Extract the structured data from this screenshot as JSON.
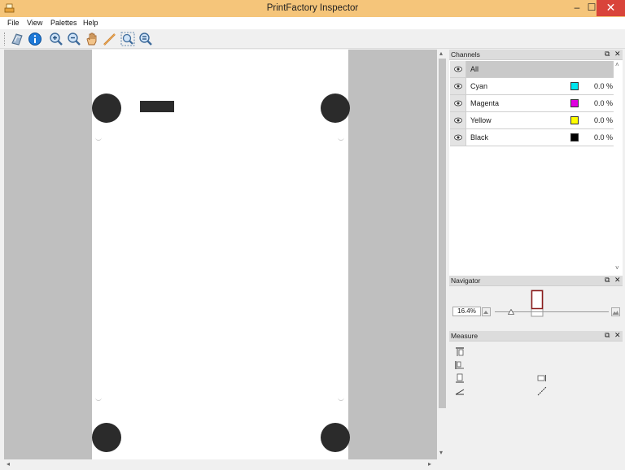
{
  "window": {
    "title": "PrintFactory Inspector",
    "controls": {
      "minimize": "–",
      "maximize": "☐",
      "close": "✕"
    }
  },
  "menu": [
    "File",
    "View",
    "Palettes",
    "Help"
  ],
  "toolbar": {
    "tools": [
      "open-file",
      "info",
      "zoom-in",
      "zoom-out",
      "pan-hand",
      "measure-ruler",
      "zoom-fit",
      "zoom-actual"
    ]
  },
  "palettes": {
    "channels": {
      "title": "Channels",
      "rows": [
        {
          "name": "All",
          "color": "",
          "percent": "",
          "selected": true
        },
        {
          "name": "Cyan",
          "color": "#00e5ee",
          "percent": "0.0 %",
          "selected": false
        },
        {
          "name": "Magenta",
          "color": "#e000e0",
          "percent": "0.0 %",
          "selected": false
        },
        {
          "name": "Yellow",
          "color": "#ffff00",
          "percent": "0.0 %",
          "selected": false
        },
        {
          "name": "Black",
          "color": "#000000",
          "percent": "0.0 %",
          "selected": false
        }
      ]
    },
    "navigator": {
      "title": "Navigator",
      "zoom": "16.4%"
    },
    "measure": {
      "title": "Measure"
    },
    "float_icon": "⧉",
    "close_icon": "✕"
  },
  "colors": {
    "titlebar": "#f5c57a",
    "close_button": "#d9443a",
    "canvas_background": "#bfbfbf",
    "registration_mark": "#2b2b2b",
    "navigator_frame": "#8b1a1a"
  }
}
